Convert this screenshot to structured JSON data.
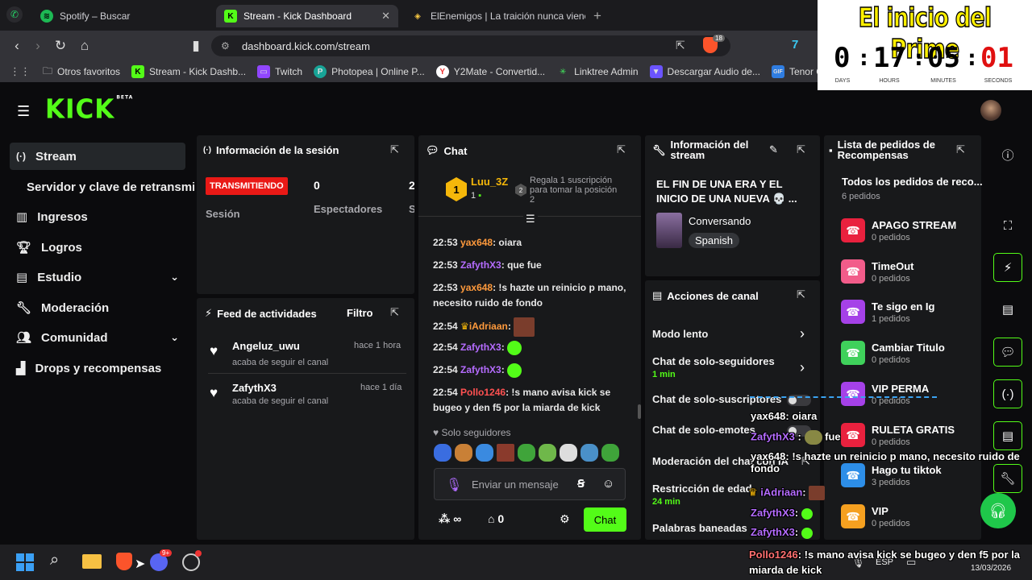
{
  "browser": {
    "tabs": [
      {
        "label": "Spotify – Buscar",
        "icon": "spotify-icon"
      },
      {
        "label": "Stream - Kick Dashboard",
        "icon": "kick-icon"
      },
      {
        "label": "ElEnemigos | La traición nunca viene",
        "icon": "tag-icon"
      }
    ],
    "url": "dashboard.kick.com/stream",
    "brave_badge": "18",
    "bookmarks": [
      "Otros favoritos",
      "Stream - Kick Dashb...",
      "Twitch",
      "Photopea | Online P...",
      "Y2Mate - Convertid...",
      "Linktree Admin",
      "Descargar Audio de...",
      "Tenor GIF Key"
    ]
  },
  "overlay": {
    "title": "El inicio del Prime",
    "timer": {
      "days": "0",
      "hours": "17",
      "minutes": "05",
      "seconds": "01"
    },
    "labels": {
      "days": "DAYS",
      "hours": "HOURS",
      "minutes": "MINUTES",
      "seconds": "SECONDS"
    },
    "chat": [
      {
        "user": "yax648",
        "text": ": oiara"
      },
      {
        "user": "ZafythX3",
        "text": ":",
        "after": "fue"
      },
      {
        "user": "yax648",
        "text": ": !s hazte un reinicio p mano, necesito ruido de fondo"
      },
      {
        "user": "iAdriaan",
        "text": ":"
      },
      {
        "user": "ZafythX3",
        "text": ":"
      },
      {
        "user": "ZafythX3",
        "text": ":"
      },
      {
        "user": "Pollo1246",
        "text": ": !s mano avisa kick se bugeo y den f5 por la miarda de kick"
      }
    ]
  },
  "kick": {
    "logo": "KICK",
    "beta": "BETA",
    "sidebar": [
      {
        "label": "Stream",
        "icon": "broadcast-icon"
      },
      {
        "label": "Servidor y clave de retransmisión",
        "icon": ""
      },
      {
        "label": "Ingresos",
        "icon": "chart-icon"
      },
      {
        "label": "Logros",
        "icon": "trophy-icon"
      },
      {
        "label": "Estudio",
        "icon": "layout-icon"
      },
      {
        "label": "Moderación",
        "icon": "wrench-icon"
      },
      {
        "label": "Comunidad",
        "icon": "users-icon"
      },
      {
        "label": "Drops y recompensas",
        "icon": "gift-icon"
      }
    ],
    "session": {
      "title": "Información de la sesión",
      "status": "TRANSMITIENDO",
      "session_label": "Sesión",
      "viewers_value": "0",
      "viewers_label": "Espectadores",
      "extra_value": "2",
      "extra_label": "S"
    },
    "feed": {
      "title": "Feed de actividades",
      "filter": "Filtro",
      "items": [
        {
          "user": "Angeluz_uwu",
          "time": "hace 1 hora",
          "action": "acaba de seguir el canal"
        },
        {
          "user": "ZafythX3",
          "time": "hace 1 día",
          "action": "acaba de seguir el canal"
        }
      ]
    },
    "chat": {
      "title": "Chat",
      "top_user": "Luu_3Z",
      "top_rank": "1",
      "top_count": "1",
      "rank2": "2",
      "gift_text": "Regala 1 suscripción para tomar la posición 2",
      "messages": [
        {
          "time": "22:53",
          "user": "yax648",
          "text": ": oiara"
        },
        {
          "time": "22:53",
          "user": "ZafythX3",
          "text": ": que fue"
        },
        {
          "time": "22:53",
          "user": "yax648",
          "text": ": !s hazte un reinicio p mano, necesito ruido de fondo"
        },
        {
          "time": "22:54",
          "user": "iAdriaan",
          "text": ":"
        },
        {
          "time": "22:54",
          "user": "ZafythX3",
          "text": ":"
        },
        {
          "time": "22:54",
          "user": "ZafythX3",
          "text": ":"
        },
        {
          "time": "22:54",
          "user": "Pollo1246",
          "text": ": !s mano avisa kick se bugeo y den f5 por la miarda de kick"
        }
      ],
      "mode": "Solo seguidores",
      "placeholder": "Enviar un mensaje",
      "points": "∞",
      "store_count": "0",
      "send": "Chat"
    },
    "stream_info": {
      "title": "Información del stream",
      "stream_title": "EL FIN DE UNA ERA Y EL INICIO DE UNA NUEVA 💀 ...",
      "category": "Conversando",
      "language": "Spanish"
    },
    "actions": {
      "title": "Acciones de canal",
      "items": [
        {
          "label": "Modo lento",
          "sub": ""
        },
        {
          "label": "Chat de solo-seguidores",
          "sub": "1 min"
        },
        {
          "label": "Chat de solo-suscriptores",
          "sub": ""
        },
        {
          "label": "Chat de solo-emotes",
          "sub": ""
        },
        {
          "label": "Moderación del chat con IA",
          "sub": ""
        },
        {
          "label": "Restricción de edad",
          "sub": "24 min"
        },
        {
          "label": "Palabras baneadas",
          "sub": ""
        }
      ]
    },
    "rewards": {
      "title": "Lista de pedidos de Recompensas",
      "all_label": "Todos los pedidos de reco...",
      "all_count": "6 pedidos",
      "items": [
        {
          "title": "APAGO STREAM",
          "count": "0 pedidos",
          "color": "#e9213e"
        },
        {
          "title": "TimeOut",
          "count": "0 pedidos",
          "color": "#f25c8a"
        },
        {
          "title": "Te sigo en Ig",
          "count": "1 pedidos",
          "color": "#a541e8"
        },
        {
          "title": "Cambiar Titulo",
          "count": "0 pedidos",
          "color": "#3fd15b"
        },
        {
          "title": "VIP PERMA",
          "count": "0 pedidos",
          "color": "#a541e8"
        },
        {
          "title": "RULETA GRATIS",
          "count": "0 pedidos",
          "color": "#e9213e"
        },
        {
          "title": "Hago tu tiktok",
          "count": "3 pedidos",
          "color": "#2d8ee8"
        },
        {
          "title": "VIP",
          "count": "0 pedidos",
          "color": "#f5a020"
        }
      ]
    }
  },
  "taskbar": {
    "lang": "ESP",
    "date": "13/03/2026",
    "discord_badge": "9+"
  }
}
